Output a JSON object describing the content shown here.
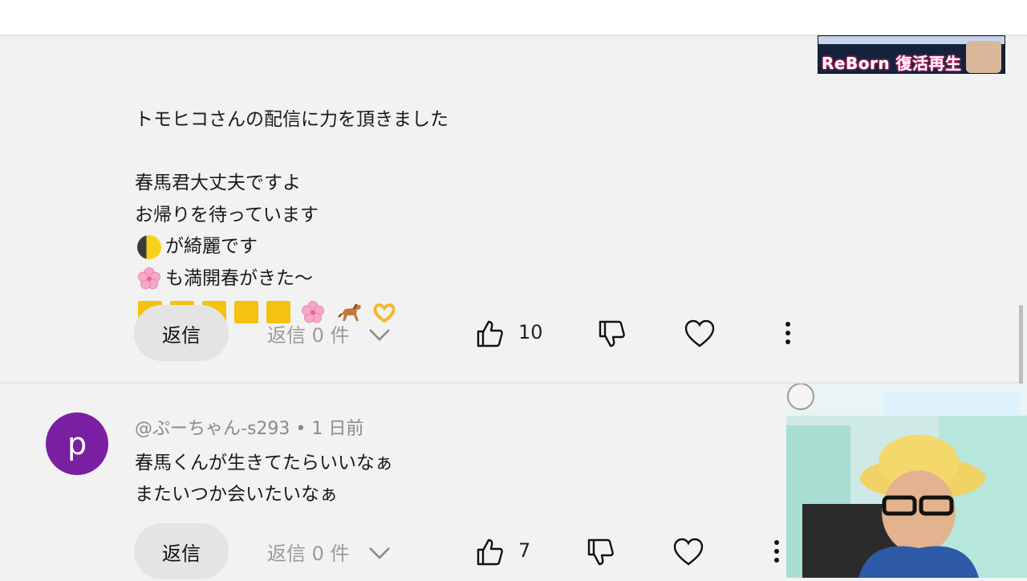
{
  "comment1": {
    "lines": [
      "トモヒコさんの配信に力を頂きました",
      "",
      "春馬君大丈夫ですよ",
      "お帰りを待っています",
      "が綺麗です",
      "も満開春がきた〜"
    ],
    "reply_label": "返信",
    "replies_label": "返信 0 件",
    "likes": "10"
  },
  "comment2": {
    "avatar_letter": "p",
    "handle": "@ぷーちゃん-s293 • 1 日前",
    "lines": [
      "春馬くんが生きてたらいいなぁ",
      "またいつか会いたいなぁ"
    ],
    "reply_label": "返信",
    "replies_label": "返信 0 件",
    "likes": "7"
  },
  "overlay": {
    "thumb_title": "ReBorn 復活再生"
  },
  "colors": {
    "avatar_bg": "#7b1fa2",
    "reply_btn_bg": "#e4e4e4",
    "muted_text": "#9a9a9a"
  },
  "icons": [
    "thumbs-up-icon",
    "thumbs-down-icon",
    "heart-icon",
    "more-vert-icon",
    "chevron-down-icon",
    "moon-emoji",
    "cherry-blossom-emoji",
    "horse-emoji",
    "heart-hands-emoji"
  ]
}
